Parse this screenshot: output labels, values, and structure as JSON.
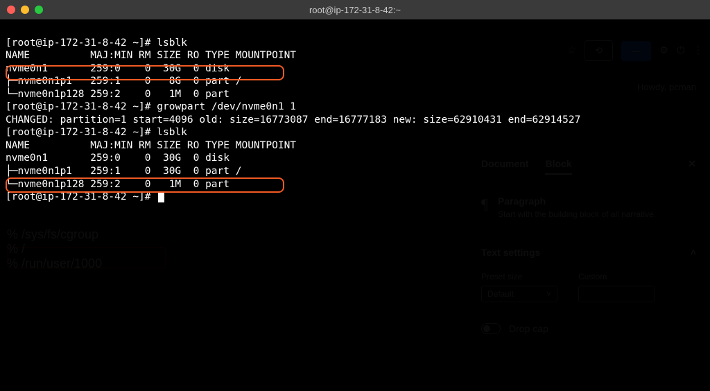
{
  "window": {
    "title": "root@ip-172-31-8-42:~"
  },
  "terminal": {
    "prompt": "[root@ip-172-31-8-42 ~]# ",
    "cmd1": "lsblk",
    "header": "NAME          MAJ:MIN RM SIZE RO TYPE MOUNTPOINT",
    "t1r1": "nvme0n1       259:0    0  30G  0 disk",
    "t1r2": "├─nvme0n1p1   259:1    0   8G  0 part /",
    "t1r3": "└─nvme0n1p128 259:2    0   1M  0 part",
    "cmd2": "growpart /dev/nvme0n1 1",
    "growout": "CHANGED: partition=1 start=4096 old: size=16773087 end=16777183 new: size=62910431 end=62914527",
    "cmd3": "lsblk",
    "t2r1": "nvme0n1       259:0    0  30G  0 disk",
    "t2r2": "├─nvme0n1p1   259:1    0  30G  0 part /",
    "t2r3": "└─nvme0n1p128 259:2    0   1M  0 part"
  },
  "bg": {
    "howdy": "Howdy, pcman",
    "tabs": {
      "document": "Document",
      "block": "Block"
    },
    "block_title": "Paragraph",
    "block_desc": "Start with the building block of all narrative.",
    "text_settings": "Text settings",
    "preset": "Preset size",
    "custom": "Custom",
    "default": "Default",
    "dropcap": "Drop cap",
    "faded1": "% /sys/fs/cgroup",
    "faded2": "% /",
    "faded3": "% /run/user/1000"
  }
}
